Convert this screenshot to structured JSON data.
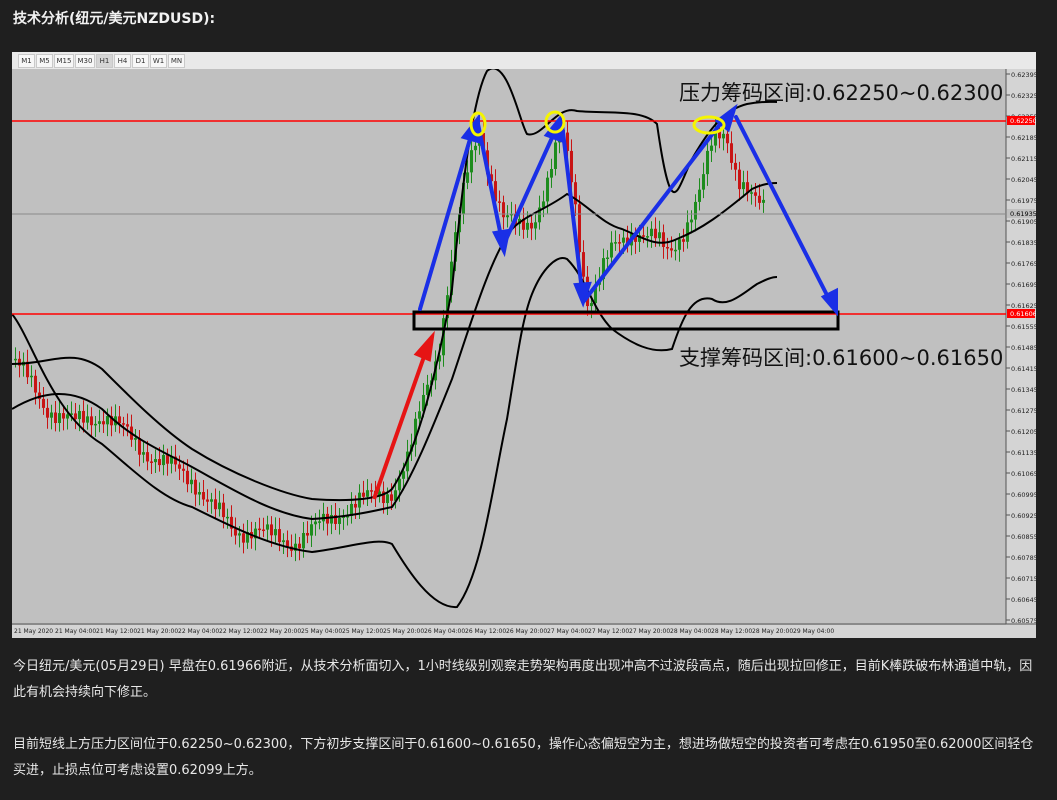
{
  "title": "技术分析(纽元/美元NZDUSD):",
  "timeframes": [
    "M1",
    "M5",
    "M15",
    "M30",
    "H1",
    "H4",
    "D1",
    "W1",
    "MN"
  ],
  "active_timeframe": "H1",
  "annotations": {
    "resistance": "压力筹码区间:0.62250~0.62300",
    "support": "支撑筹码区间:0.61600~0.61650"
  },
  "price_axis": [
    "0.62395",
    "0.62325",
    "0.62255",
    "0.62185",
    "0.62115",
    "0.62045",
    "0.61975",
    "0.61905",
    "0.61835",
    "0.61765",
    "0.61695",
    "0.61625",
    "0.61555",
    "0.61485",
    "0.61415",
    "0.61345",
    "0.61275",
    "0.61205",
    "0.61135",
    "0.61065",
    "0.60995",
    "0.60925",
    "0.60855",
    "0.60785",
    "0.60715",
    "0.60645",
    "0.60575"
  ],
  "price_tags": {
    "resistance_line": "0.62250",
    "current": "0.61935",
    "support_line": "0.61606"
  },
  "time_axis": [
    "21 May 2020",
    "21 May 04:00",
    "21 May 12:00",
    "21 May 20:00",
    "22 May 04:00",
    "22 May 12:00",
    "22 May 20:00",
    "25 May 04:00",
    "25 May 12:00",
    "25 May 20:00",
    "26 May 04:00",
    "26 May 12:00",
    "26 May 20:00",
    "27 May 04:00",
    "27 May 12:00",
    "27 May 20:00",
    "28 May 04:00",
    "28 May 12:00",
    "28 May 20:00",
    "29 May 04:00"
  ],
  "colors": {
    "bull": "#1e8c1e",
    "bear": "#c81414",
    "band": "#000000",
    "hline": "#ff0000",
    "blue_arrow": "#1a2fe6",
    "red_arrow": "#e61414",
    "circle": "#f5f500",
    "chart_bg": "#c0c0c0"
  },
  "paragraphs": [
    "今日纽元/美元(05月29日) 早盘在0.61966附近，从技术分析面切入，1小时线级别观察走势架构再度出现冲高不过波段高点，随后出现拉回修正，目前K棒跌破布林通道中轨，因此有机会持续向下修正。",
    "目前短线上方压力区间位于0.62250~0.62300，下方初步支撑区间于0.61600~0.61650，操作心态偏短空为主，想进场做短空的投资者可考虑在0.61950至0.62000区间轻仓买进，止损点位可考虑设置0.62099上方。"
  ]
}
